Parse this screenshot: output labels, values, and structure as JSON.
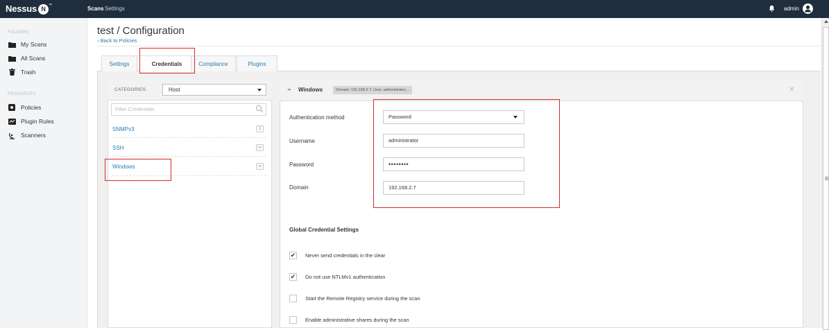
{
  "topbar": {
    "logo": "Nessus",
    "logo_badge": "N",
    "logo_tm": "™",
    "nav": [
      "Scans",
      "Settings"
    ],
    "user": "admin"
  },
  "sidebar": {
    "folders_heading": "FOLDERS",
    "folders": [
      {
        "label": "My Scans",
        "icon": "folder-icon"
      },
      {
        "label": "All Scans",
        "icon": "folder-icon"
      },
      {
        "label": "Trash",
        "icon": "trash-icon"
      }
    ],
    "resources_heading": "RESOURCES",
    "resources": [
      {
        "label": "Policies",
        "icon": "shield-icon"
      },
      {
        "label": "Plugin Rules",
        "icon": "plugin-rules-icon"
      },
      {
        "label": "Scanners",
        "icon": "scanner-icon"
      }
    ]
  },
  "page": {
    "title": "test / Configuration",
    "back_link": "‹ Back to Policies"
  },
  "tabs": [
    "Settings",
    "Credentials",
    "Compliance",
    "Plugins"
  ],
  "active_tab": "Credentials",
  "credentials": {
    "categories_label": "CATEGORIES",
    "category_value": "Host",
    "filter_placeholder": "Filter Credentials",
    "items": [
      {
        "label": "SNMPv3",
        "badge": "1"
      },
      {
        "label": "SSH",
        "badge": "∞"
      },
      {
        "label": "Windows",
        "badge": "∞"
      }
    ]
  },
  "windows_config": {
    "title": "Windows",
    "summary": "Domain: 192.168.2.7, User: administrator,...",
    "close": "✕",
    "fields": [
      {
        "label": "Authentication method",
        "value": "Password",
        "type": "select"
      },
      {
        "label": "Username",
        "value": "administrator",
        "type": "text"
      },
      {
        "label": "Password",
        "value": "••••••••",
        "type": "password"
      },
      {
        "label": "Domain",
        "value": "192.168.2.7",
        "type": "text"
      }
    ],
    "global_heading": "Global Credential Settings",
    "global_options": [
      {
        "label": "Never send credentials in the clear",
        "checked": true
      },
      {
        "label": "Do not use NTLMv1 authentication",
        "checked": true
      },
      {
        "label": "Start the Remote Registry service during the scan",
        "checked": false
      },
      {
        "label": "Enable administrative shares during the scan",
        "checked": false
      }
    ]
  },
  "colors": {
    "topbar": "#1f2d3d",
    "link": "#2a7ab0",
    "highlight": "#d32a2a"
  }
}
